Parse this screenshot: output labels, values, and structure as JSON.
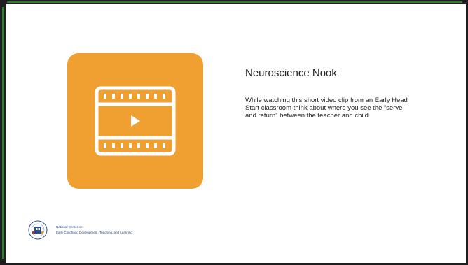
{
  "slide": {
    "title": "Neuroscience Nook",
    "body": "While watching this short video clip from an Early Head Start classroom think about where you see the “serve and return” between the teacher and child.",
    "video_icon": "film-play-icon",
    "colors": {
      "tile": "#f0a030",
      "frame_dark": "#1f1f1f",
      "frame_accent": "#2e7d32",
      "text": "#222222"
    }
  },
  "footer": {
    "org_line1": "National Center on",
    "org_line2": "Early Childhood Development, Teaching, and Learning",
    "logo_icon": "head-start-seal-icon"
  }
}
